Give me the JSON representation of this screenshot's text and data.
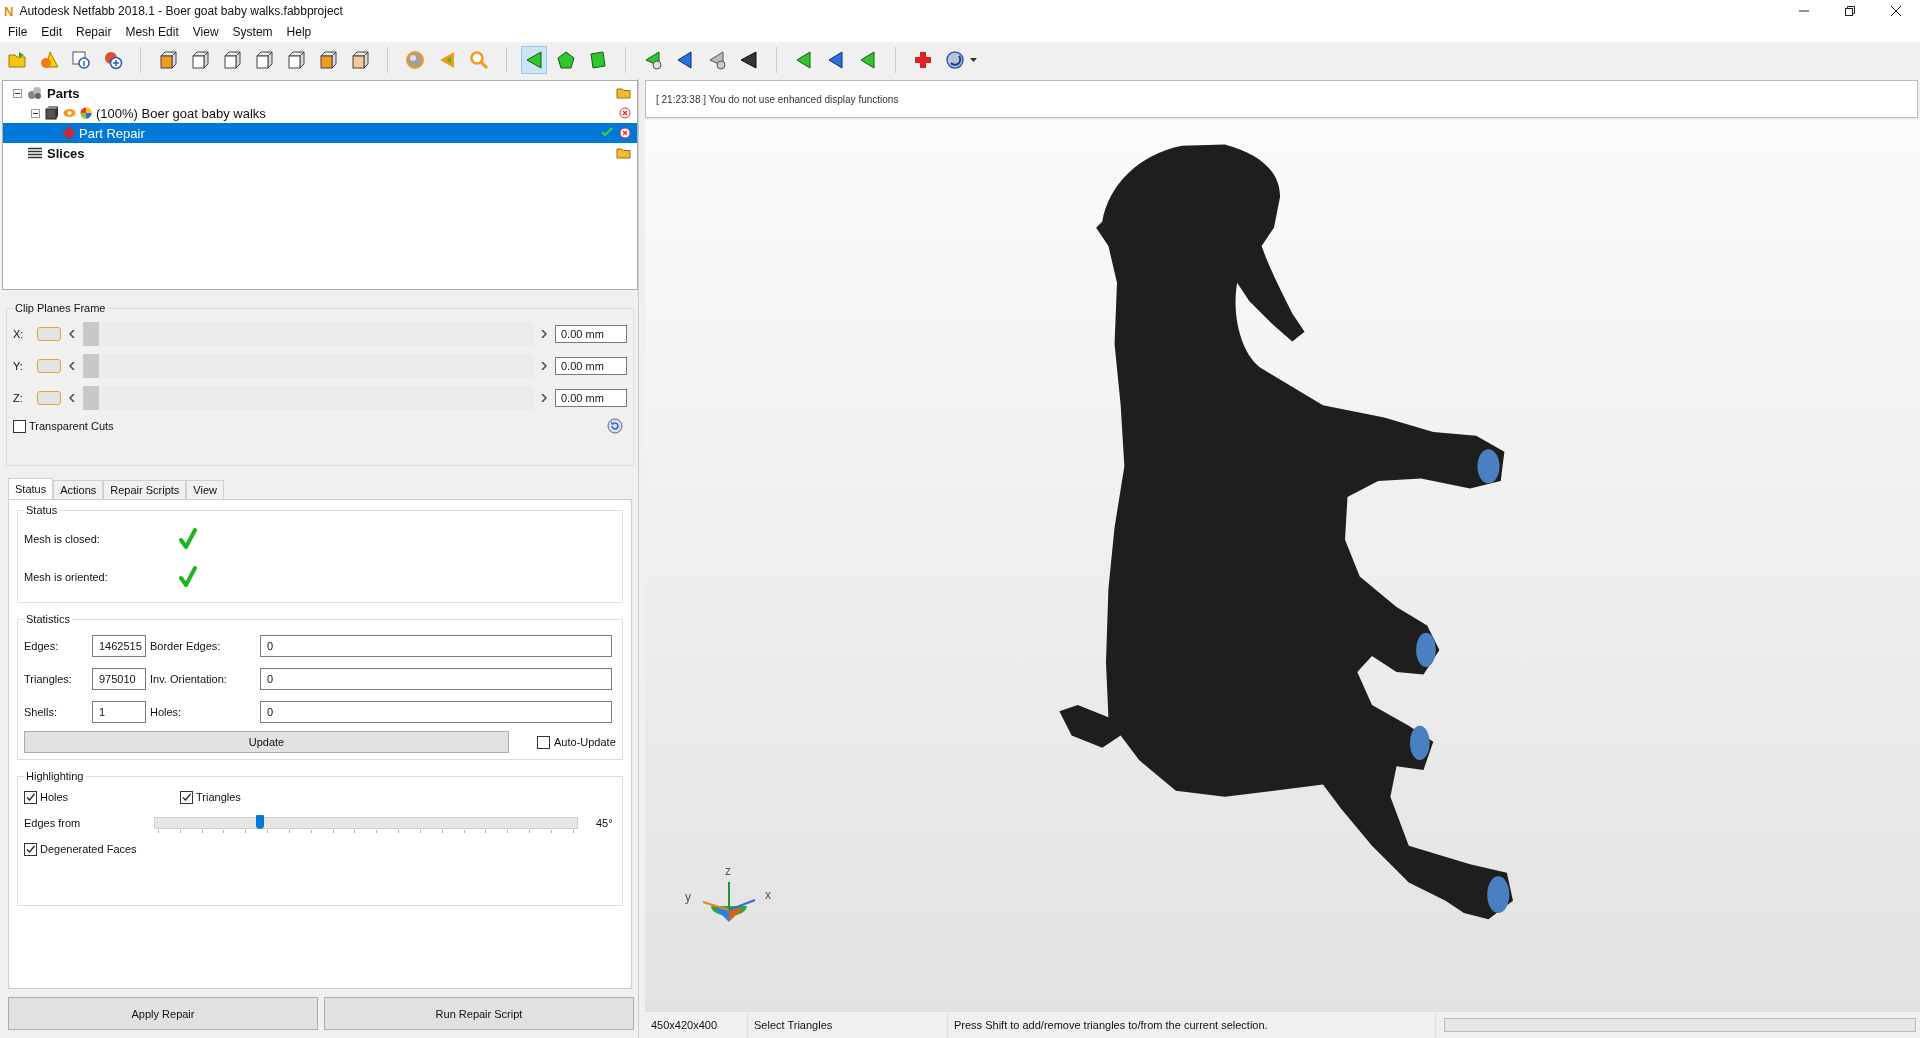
{
  "window": {
    "app_icon": "N",
    "title": "Autodesk Netfabb 2018.1 - Boer goat baby walks.fabbproject"
  },
  "menu": [
    "File",
    "Edit",
    "Repair",
    "Mesh Edit",
    "View",
    "System",
    "Help"
  ],
  "toolbar": [
    {
      "tools": [
        {
          "selected": false
        },
        {
          "selected": false
        },
        {
          "selected": false
        },
        {
          "selected": false
        }
      ]
    },
    {
      "tools": [
        {
          "selected": false
        },
        {
          "selected": false
        },
        {
          "selected": false
        },
        {
          "selected": false
        },
        {
          "selected": false
        },
        {
          "selected": false
        },
        {
          "selected": false
        }
      ]
    },
    {
      "tools": [
        {
          "selected": false
        },
        {
          "selected": false
        },
        {
          "selected": false
        }
      ]
    },
    {
      "tools": [
        {
          "selected": true
        },
        {
          "selected": false
        },
        {
          "selected": false
        }
      ]
    },
    {
      "tools": [
        {
          "selected": false
        },
        {
          "selected": false
        },
        {
          "selected": false
        },
        {
          "selected": false
        }
      ]
    },
    {
      "tools": [
        {
          "selected": false
        },
        {
          "selected": false
        },
        {
          "selected": false
        }
      ]
    },
    {
      "tools": [
        {
          "selected": false
        },
        {
          "selected": false
        }
      ]
    }
  ],
  "tree": [
    {
      "kind": "group",
      "label": "Parts",
      "expanded": true,
      "selected": false,
      "children": [
        {
          "kind": "part",
          "label": "(100%) Boer goat baby walks",
          "expanded": true,
          "selected": false,
          "children": [
            {
              "kind": "repair",
              "label": "Part Repair",
              "selected": true
            }
          ]
        }
      ]
    },
    {
      "kind": "group",
      "label": "Slices",
      "selected": false
    }
  ],
  "clip_planes": {
    "title": "Clip Planes Frame",
    "axes": [
      {
        "label": "X:",
        "on": false,
        "level": 0,
        "value": "0.00 mm"
      },
      {
        "label": "Y:",
        "on": false,
        "level": 0,
        "value": "0.00 mm"
      },
      {
        "label": "Z:",
        "on": false,
        "level": 0,
        "value": "0.00 mm"
      }
    ],
    "transparent_cuts": {
      "label": "Transparent Cuts",
      "checked": false
    }
  },
  "tabs": [
    {
      "label": "Status",
      "selected": true
    },
    {
      "label": "Actions",
      "selected": false
    },
    {
      "label": "Repair Scripts",
      "selected": false
    },
    {
      "label": "View",
      "selected": false
    }
  ],
  "status": {
    "title": "Status",
    "items": [
      {
        "label": "Mesh is closed:",
        "ok": true
      },
      {
        "label": "Mesh is oriented:",
        "ok": true
      }
    ]
  },
  "statistics": {
    "title": "Statistics",
    "rows": [
      {
        "label": "Edges:",
        "value": "1462515",
        "label2": "Border Edges:",
        "value2": "0"
      },
      {
        "label": "Triangles:",
        "value": "975010",
        "label2": "Inv. Orientation:",
        "value2": "0"
      },
      {
        "label": "Shells:",
        "value": "1",
        "label2": "Holes:",
        "value2": "0"
      }
    ],
    "update_button": "Update",
    "auto_update": {
      "label": "Auto-Update",
      "checked": false
    }
  },
  "highlighting": {
    "title": "Highlighting",
    "holes": {
      "label": "Holes",
      "checked": true
    },
    "triangles": {
      "label": "Triangles",
      "checked": true
    },
    "edges_from": {
      "label": "Edges from",
      "level": 0.25,
      "reading": "45°"
    },
    "degenerated_faces": {
      "label": "Degenerated Faces",
      "checked": true
    }
  },
  "actions": [
    "Apply Repair",
    "Run Repair Script"
  ],
  "log": [
    "[ 21:23:38 ] You do not use enhanced display functions"
  ],
  "axes_gizmo": {
    "labels": [
      "z",
      "y",
      "x"
    ]
  },
  "status_bar": {
    "dimensions": "450x420x400",
    "mode": "Select Triangles",
    "hint": "Press Shift to add/remove triangles to/from the current selection.",
    "progress": {
      "level": 0
    }
  }
}
